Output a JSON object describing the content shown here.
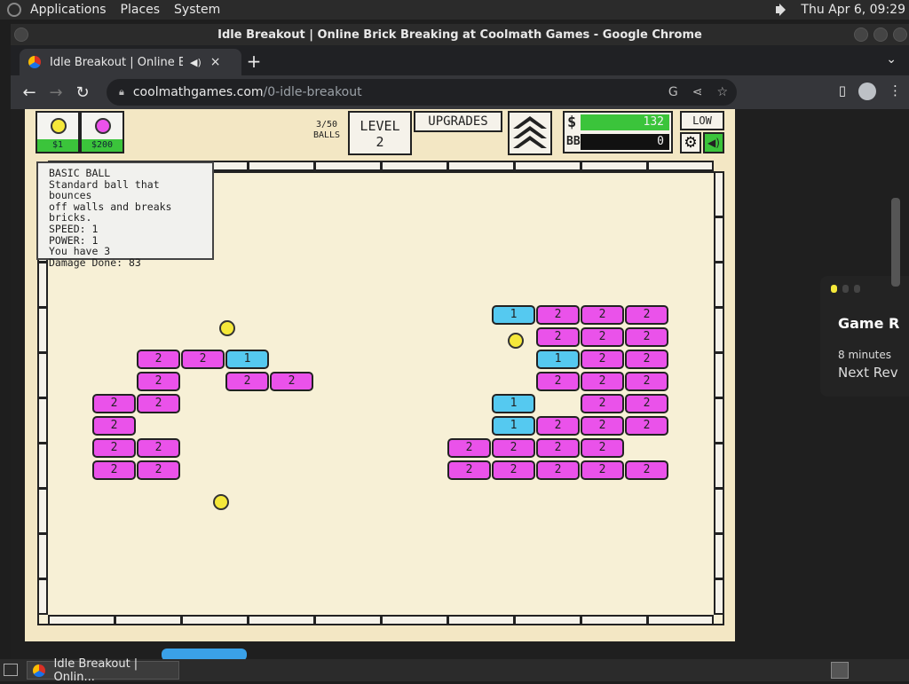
{
  "panel": {
    "applications": "Applications",
    "places": "Places",
    "system": "System",
    "clock": "Thu Apr  6, 09:29"
  },
  "window": {
    "title": "Idle Breakout | Online Brick Breaking at Coolmath Games - Google Chrome"
  },
  "tab": {
    "title": "Idle Breakout | Online Bric",
    "mute_icon": "speaker-icon",
    "close": "×"
  },
  "toolbar": {
    "url_domain": "coolmathgames.com",
    "url_path": "/0-idle-breakout"
  },
  "game": {
    "shop": [
      {
        "price": "$1",
        "color": "#f5e83a"
      },
      {
        "price": "$200",
        "color": "#ea52ea"
      }
    ],
    "balls_count": "3/50",
    "balls_label": "BALLS",
    "level_label": "LEVEL",
    "level_value": "2",
    "upgrades_label": "UPGRADES",
    "money_symbol": "$",
    "money_value": "132",
    "bb_label": "BB",
    "bb_value": "0",
    "quality_label": "LOW",
    "tooltip": {
      "line1": "BASIC BALL",
      "line2": "Standard ball that bounces",
      "line3": "off walls and breaks bricks.",
      "line4": "SPEED: 1",
      "line5": "POWER: 1",
      "line6": "You have 3",
      "line7": "Damage Done: 83"
    },
    "bricks": [
      {
        "col": 0,
        "row": 0,
        "v": "2",
        "t": "pink"
      },
      {
        "col": 1,
        "row": 0,
        "v": "2",
        "t": "pink"
      },
      {
        "col": 2,
        "row": 0,
        "v": "1",
        "t": "cyan"
      },
      {
        "col": 0,
        "row": 1,
        "v": "2",
        "t": "pink"
      },
      {
        "col": 2,
        "row": 1,
        "v": "2",
        "t": "pink"
      },
      {
        "col": 3,
        "row": 1,
        "v": "2",
        "t": "pink"
      },
      {
        "col": -1,
        "row": 2,
        "v": "2",
        "t": "pink"
      },
      {
        "col": 0,
        "row": 2,
        "v": "2",
        "t": "pink"
      },
      {
        "col": -1,
        "row": 3,
        "v": "2",
        "t": "pink"
      },
      {
        "col": -1,
        "row": 4,
        "v": "2",
        "t": "pink"
      },
      {
        "col": 0,
        "row": 4,
        "v": "2",
        "t": "pink"
      },
      {
        "col": -1,
        "row": 5,
        "v": "2",
        "t": "pink"
      },
      {
        "col": 0,
        "row": 5,
        "v": "2",
        "t": "pink"
      },
      {
        "col": 8,
        "row": -2,
        "v": "1",
        "t": "cyan"
      },
      {
        "col": 9,
        "row": -2,
        "v": "2",
        "t": "pink"
      },
      {
        "col": 10,
        "row": -2,
        "v": "2",
        "t": "pink"
      },
      {
        "col": 11,
        "row": -2,
        "v": "2",
        "t": "pink"
      },
      {
        "col": 9,
        "row": -1,
        "v": "2",
        "t": "pink"
      },
      {
        "col": 10,
        "row": -1,
        "v": "2",
        "t": "pink"
      },
      {
        "col": 11,
        "row": -1,
        "v": "2",
        "t": "pink"
      },
      {
        "col": 9,
        "row": 0,
        "v": "1",
        "t": "cyan"
      },
      {
        "col": 10,
        "row": 0,
        "v": "2",
        "t": "pink"
      },
      {
        "col": 11,
        "row": 0,
        "v": "2",
        "t": "pink"
      },
      {
        "col": 9,
        "row": 1,
        "v": "2",
        "t": "pink"
      },
      {
        "col": 10,
        "row": 1,
        "v": "2",
        "t": "pink"
      },
      {
        "col": 11,
        "row": 1,
        "v": "2",
        "t": "pink"
      },
      {
        "col": 8,
        "row": 2,
        "v": "1",
        "t": "cyan"
      },
      {
        "col": 10,
        "row": 2,
        "v": "2",
        "t": "pink"
      },
      {
        "col": 11,
        "row": 2,
        "v": "2",
        "t": "pink"
      },
      {
        "col": 8,
        "row": 3,
        "v": "1",
        "t": "cyan"
      },
      {
        "col": 9,
        "row": 3,
        "v": "2",
        "t": "pink"
      },
      {
        "col": 10,
        "row": 3,
        "v": "2",
        "t": "pink"
      },
      {
        "col": 11,
        "row": 3,
        "v": "2",
        "t": "pink"
      },
      {
        "col": 7,
        "row": 4,
        "v": "2",
        "t": "pink"
      },
      {
        "col": 8,
        "row": 4,
        "v": "2",
        "t": "pink"
      },
      {
        "col": 9,
        "row": 4,
        "v": "2",
        "t": "pink"
      },
      {
        "col": 10,
        "row": 4,
        "v": "2",
        "t": "pink"
      },
      {
        "col": 7,
        "row": 5,
        "v": "2",
        "t": "pink"
      },
      {
        "col": 8,
        "row": 5,
        "v": "2",
        "t": "pink"
      },
      {
        "col": 9,
        "row": 5,
        "v": "2",
        "t": "pink"
      },
      {
        "col": 10,
        "row": 5,
        "v": "2",
        "t": "pink"
      },
      {
        "col": 11,
        "row": 5,
        "v": "2",
        "t": "pink"
      }
    ]
  },
  "side_card": {
    "heading": "Game R",
    "time": "8 minutes",
    "next": "Next Rev"
  },
  "taskbar": {
    "task_title": "Idle Breakout | Onlin..."
  }
}
